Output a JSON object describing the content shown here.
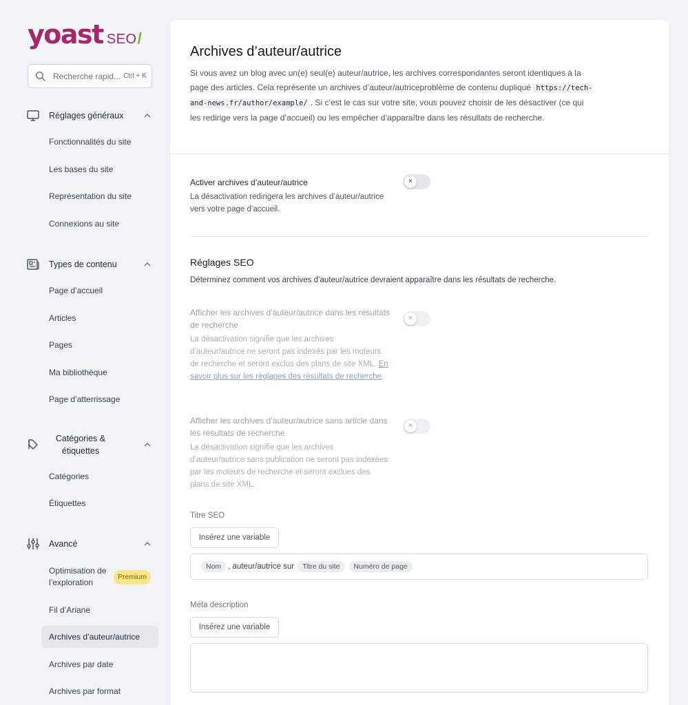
{
  "logo": {
    "brand": "yoast",
    "product": "SEO",
    "slash": "/"
  },
  "search": {
    "placeholder": "Recherche rapid...",
    "shortcut": "Ctrl + K"
  },
  "sidebar": {
    "groups": [
      {
        "label": "Réglages généraux",
        "items": [
          "Fonctionnalités du site",
          "Les bases du site",
          "Représentation du site",
          "Connexions au site"
        ]
      },
      {
        "label": "Types de contenu",
        "items": [
          "Page d’accueil",
          "Articles",
          "Pages",
          "Ma bibliothèque",
          "Page d’atterrissage"
        ]
      },
      {
        "label": "Catégories & étiquettes",
        "items": [
          "Catégories",
          "Étiquettes"
        ]
      },
      {
        "label": "Avancé",
        "items": [
          "Optimisation de l’exploration",
          "Fil d’Ariane",
          "Archives d’auteur/autrice",
          "Archives par date",
          "Archives par format"
        ]
      }
    ],
    "premium_badge": "Premium"
  },
  "main": {
    "title": "Archives d’auteur/autrice",
    "intro_before": "Si vous avez un blog avec un(e) seul(e) auteur/autrice, les archives correspondantes seront identiques à la page des articles. Cela représente un archives d’auteur/autriceproblème de contenu dupliqué ",
    "intro_code": "https://tech-and-news.fr/author/example/",
    "intro_after": ". Si c’est le cas sur votre site, vous pouvez choisir de les désactiver (ce qui les redirige vers la page d’accueil) ou les empêcher d’apparaître dans les résultats de recherche.",
    "enable": {
      "title": "Activer archives d’auteur/autrice",
      "desc": "La désactivation redirigera les archives d’auteur/autrice vers votre page d’accueil."
    },
    "seo_section": {
      "title": "Réglages SEO",
      "desc": "Déterminez comment vos archives d’auteur/autrice devraient apparaître dans les résultats de recherche."
    },
    "show_in_results": {
      "title": "Afficher les archives d’auteur/autrice dans les résultats de recherche",
      "desc": "La désactivation signifie que les archives d’auteur/autrice ne seront pas indexés par les moteurs de recherche et seront exclus des plans de site XML. ",
      "link": "En savoir plus sur les réglages des résultats de recherche",
      "after_link": "."
    },
    "show_without_posts": {
      "title": "Afficher les archives d’auteur/autrice sans article dans les résultats de recherche",
      "desc": "La désactivation signifie que les archives d’auteur/autrice sans publication ne seront pas indexées par les moteurs de recherche et seront exclues des plans de site XML."
    },
    "seo_title": {
      "label": "Titre SEO",
      "insert_variable": "Insérez une variable",
      "pill1": "Nom",
      "text": ", auteur/autrice sur",
      "pill2": "Titre du site",
      "pill3": "Numéro de page"
    },
    "meta": {
      "label": "Méta description",
      "insert_variable": "Insérez une variable"
    },
    "toggle_glyph": "×"
  },
  "colors": {
    "brand": "#a4286a",
    "accent": "#77b227"
  }
}
